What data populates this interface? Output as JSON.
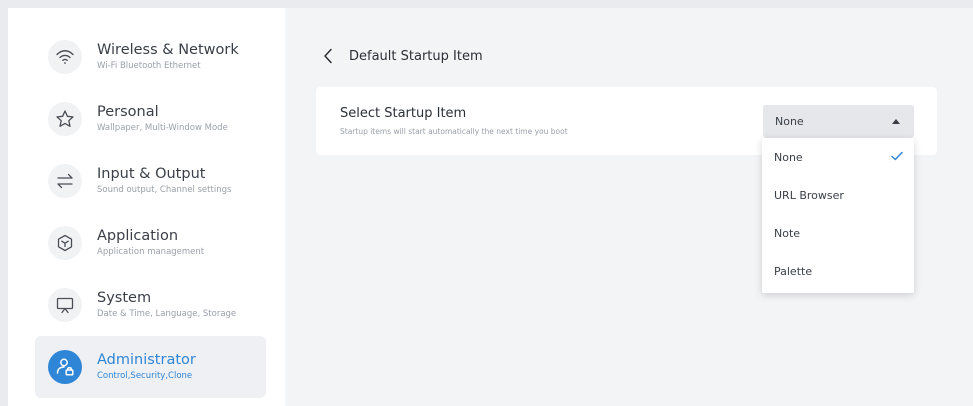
{
  "sidebar": {
    "items": [
      {
        "title": "Wireless & Network",
        "subtitle": "Wi-Fi Bluetooth Ethernet",
        "icon": "wifi-icon"
      },
      {
        "title": "Personal",
        "subtitle": "Wallpaper, Multi-Window Mode",
        "icon": "star-icon"
      },
      {
        "title": "Input & Output",
        "subtitle": "Sound output, Channel settings",
        "icon": "swap-arrows-icon"
      },
      {
        "title": "Application",
        "subtitle": "Application management",
        "icon": "app-box-icon"
      },
      {
        "title": "System",
        "subtitle": "Date & Time, Language, Storage",
        "icon": "monitor-icon"
      },
      {
        "title": "Administrator",
        "subtitle": "Control,Security,Clone",
        "icon": "admin-user-icon",
        "active": true
      }
    ]
  },
  "header": {
    "title": "Default Startup Item",
    "back_icon": "chevron-left-icon"
  },
  "card": {
    "title": "Select Startup Item",
    "description": "Startup items will start automatically the next time you boot"
  },
  "select": {
    "value": "None",
    "options": [
      "None",
      "URL Browser",
      "Note",
      "Palette"
    ],
    "selected_index": 0,
    "expanded": true
  },
  "colors": {
    "accent": "#2f86d6",
    "sidebar_bg": "#ffffff",
    "content_bg": "#f3f4f6",
    "select_bg": "#e5e7ea"
  }
}
